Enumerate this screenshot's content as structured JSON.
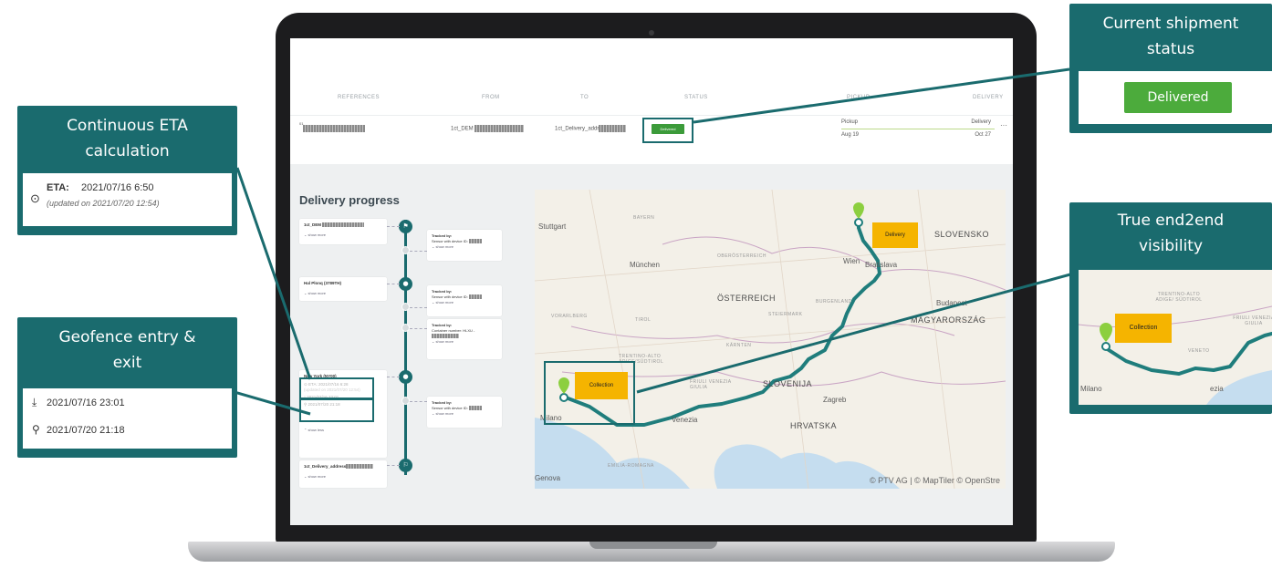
{
  "table": {
    "headers": [
      "REFERENCES",
      "FROM",
      "TO",
      "STATUS",
      "",
      "PICKUP",
      "DELIVERY"
    ],
    "row": {
      "prefix": "01",
      "from": "1ct_DEM",
      "to": "1ct_Delivery_addr",
      "status": "Delivered",
      "pickup_label": "Pickup",
      "pickup_date": "Aug 19",
      "delivery_label": "Delivery",
      "delivery_date": "Oct 27",
      "more": "···"
    }
  },
  "progress": {
    "title": "Delivery progress",
    "stops": [
      {
        "name": "1ct_DEM",
        "show_more": "show more"
      },
      {
        "name": "Hal Plonq (3789TH)",
        "show_more": "show more"
      },
      {
        "name": "New York (NY00)",
        "show_more": "show less"
      },
      {
        "name": "1ct_Delivery_address",
        "show_more": "show more"
      }
    ],
    "geofence": {
      "eta": "ETA: 2021/07/16 6:28",
      "updated": "(updated on 2021/07/20 12:54)",
      "entry": "2021/07/16 23:01",
      "exit": "2021/07/20 21:18"
    },
    "set_button": "Set",
    "tracking": [
      {
        "title": "Tracked by:",
        "body": "Sensor with device ID:",
        "show_more": "show more"
      },
      {
        "title": "Tracked by:",
        "body": "Sensor with device ID:",
        "show_more": "show more"
      },
      {
        "title": "Tracked by:",
        "body": "Container number: HLXU -",
        "show_more": "show more"
      },
      {
        "title": "Tracked by:",
        "body": "Sensor with device ID:",
        "show_more": "show more"
      }
    ]
  },
  "map": {
    "labels": {
      "stuttgart": "Stuttgart",
      "bayern": "BAYERN",
      "munchen": "München",
      "oberosterreich": "OBERÖSTERREICH",
      "wien": "Wien",
      "bratislava": "Bratislava",
      "slovensko": "SLOVENSKO",
      "osterreich": "ÖSTERREICH",
      "tirol": "TIROL",
      "vorarlberg": "VORARLBERG",
      "burgenland": "BURGENLAND",
      "steiermark": "STEIERMARK",
      "budapest": "Budapest",
      "magyarorszag": "MAGYARORSZÁG",
      "karnten": "KÄRNTEN",
      "trentino": "TRENTINO-ALTO ADIGE/SÜDTIROL",
      "friuli": "FRIULI VENEZIA GIULIA",
      "slovenija": "SLOVENIJA",
      "zagreb": "Zagreb",
      "hrvatska": "HRVATSKA",
      "milano": "Milano",
      "venezia": "Venezia",
      "emilia": "EMILIA-ROMAGNA",
      "genova": "Genova"
    },
    "delivery_tag": "Delivery",
    "collection_tag": "Collection",
    "copyright": "© PTV AG | © MapTiler © OpenStre"
  },
  "callouts": {
    "eta": {
      "title_line1": "Continuous ETA",
      "title_line2": "calculation",
      "eta_label": "ETA:",
      "eta_value": "2021/07/16 6:50",
      "updated": "(updated on 2021/07/20 12:54)"
    },
    "geofence": {
      "title_line1": "Geofence entry    &",
      "title_line2": "exit",
      "entry": "2021/07/16 23:01",
      "exit": "2021/07/20 21:18"
    },
    "status": {
      "title_line1": "Current shipment",
      "title_line2": "status",
      "badge": "Delivered"
    },
    "visibility": {
      "title_line1": "True end2end",
      "title_line2": "visibility",
      "collection_tag": "Collection",
      "milano": "Milano",
      "trentino": "TRENTINO-ALTO ADIGE/ SÜDTIROL",
      "friuli": "FRIULI VENEZIA GIULIA",
      "veneto": "VENETO",
      "venezia": "ezia"
    }
  },
  "colors": {
    "teal": "#1a6b6e",
    "green": "#4cab3c",
    "orange": "#f5b400",
    "route": "#1f7d7c"
  }
}
